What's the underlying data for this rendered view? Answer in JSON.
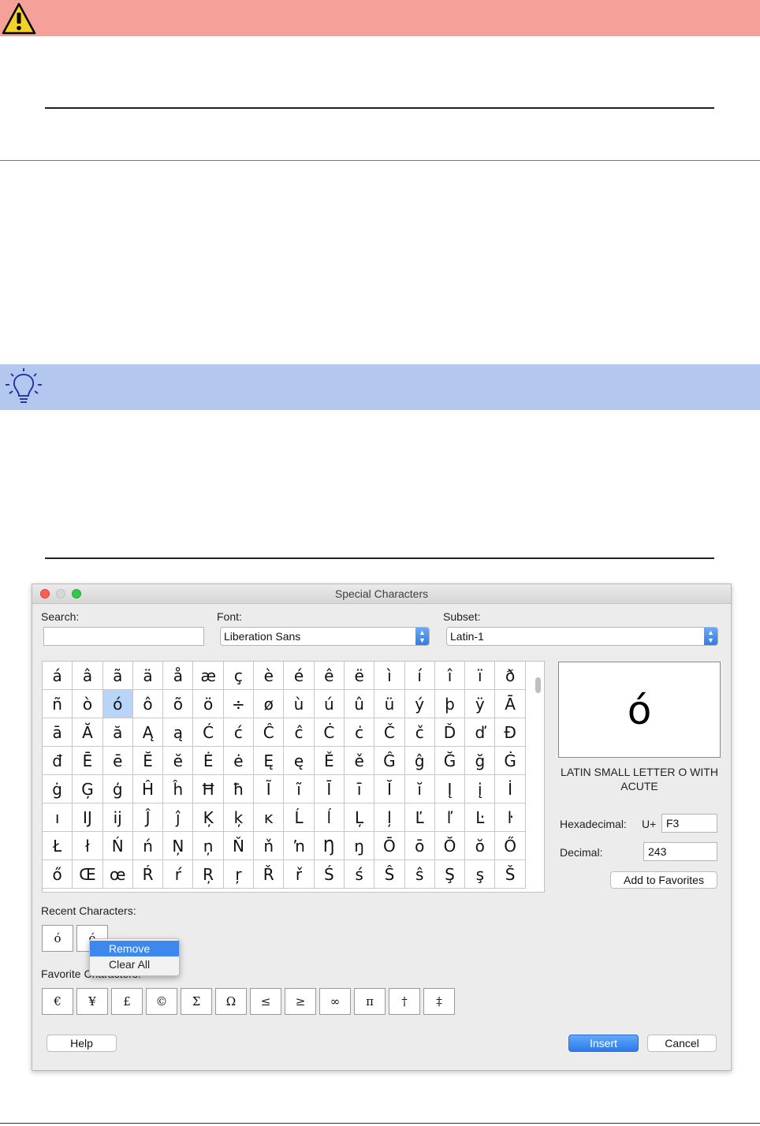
{
  "dialog": {
    "title": "Special Characters",
    "search_label": "Search:",
    "search_value": "",
    "font_label": "Font:",
    "font_value": "Liberation Sans",
    "subset_label": "Subset:",
    "subset_value": "Latin-1",
    "grid": [
      "á",
      "â",
      "ã",
      "ä",
      "å",
      "æ",
      "ç",
      "è",
      "é",
      "ê",
      "ë",
      "ì",
      "í",
      "î",
      "ï",
      "ð",
      "ñ",
      "ò",
      "ó",
      "ô",
      "õ",
      "ö",
      "÷",
      "ø",
      "ù",
      "ú",
      "û",
      "ü",
      "ý",
      "þ",
      "ÿ",
      "Ā",
      "ā",
      "Ă",
      "ă",
      "Ą",
      "ą",
      "Ć",
      "ć",
      "Ĉ",
      "ĉ",
      "Ċ",
      "ċ",
      "Č",
      "č",
      "Ď",
      "ď",
      "Đ",
      "đ",
      "Ē",
      "ē",
      "Ĕ",
      "ĕ",
      "Ė",
      "ė",
      "Ę",
      "ę",
      "Ě",
      "ě",
      "Ĝ",
      "ĝ",
      "Ğ",
      "ğ",
      "Ġ",
      "ġ",
      "Ģ",
      "ģ",
      "Ĥ",
      "ĥ",
      "Ħ",
      "ħ",
      "Ĩ",
      "ĩ",
      "Ī",
      "ī",
      "Ĭ",
      "ĭ",
      "Į",
      "į",
      "İ",
      "ı",
      "Ĳ",
      "ĳ",
      "Ĵ",
      "ĵ",
      "Ķ",
      "ķ",
      "ĸ",
      "Ĺ",
      "ĺ",
      "Ļ",
      "ļ",
      "Ľ",
      "ľ",
      "Ŀ",
      "ŀ",
      "Ł",
      "ł",
      "Ń",
      "ń",
      "Ņ",
      "ņ",
      "Ň",
      "ň",
      "ŉ",
      "Ŋ",
      "ŋ",
      "Ō",
      "ō",
      "Ŏ",
      "ŏ",
      "Ő",
      "ő",
      "Œ",
      "œ",
      "Ŕ",
      "ŕ",
      "Ŗ",
      "ŗ",
      "Ř",
      "ř",
      "Ś",
      "ś",
      "Ŝ",
      "ŝ",
      "Ş",
      "ş",
      "Š"
    ],
    "selected_index": 18,
    "preview_char": "ó",
    "char_name": "LATIN SMALL LETTER O WITH ACUTE",
    "hex_label": "Hexadecimal:",
    "hex_prefix": "U+",
    "hex_value": "F3",
    "decimal_label": "Decimal:",
    "decimal_value": "243",
    "add_favorites_label": "Add to Favorites",
    "recent_label": "Recent Characters:",
    "recent": [
      "ó",
      "é"
    ],
    "favorite_label": "Favorite Characters:",
    "favorites": [
      "€",
      "¥",
      "£",
      "©",
      "Σ",
      "Ω",
      "≤",
      "≥",
      "∞",
      "π",
      "†",
      "‡"
    ],
    "context_menu": [
      "Remove",
      "Clear All"
    ],
    "help_label": "Help",
    "insert_label": "Insert",
    "cancel_label": "Cancel"
  },
  "colors": {
    "warning_bar": "#f6a09a",
    "tip_bar": "#b4c7ee",
    "accent": "#2b7ae9"
  }
}
